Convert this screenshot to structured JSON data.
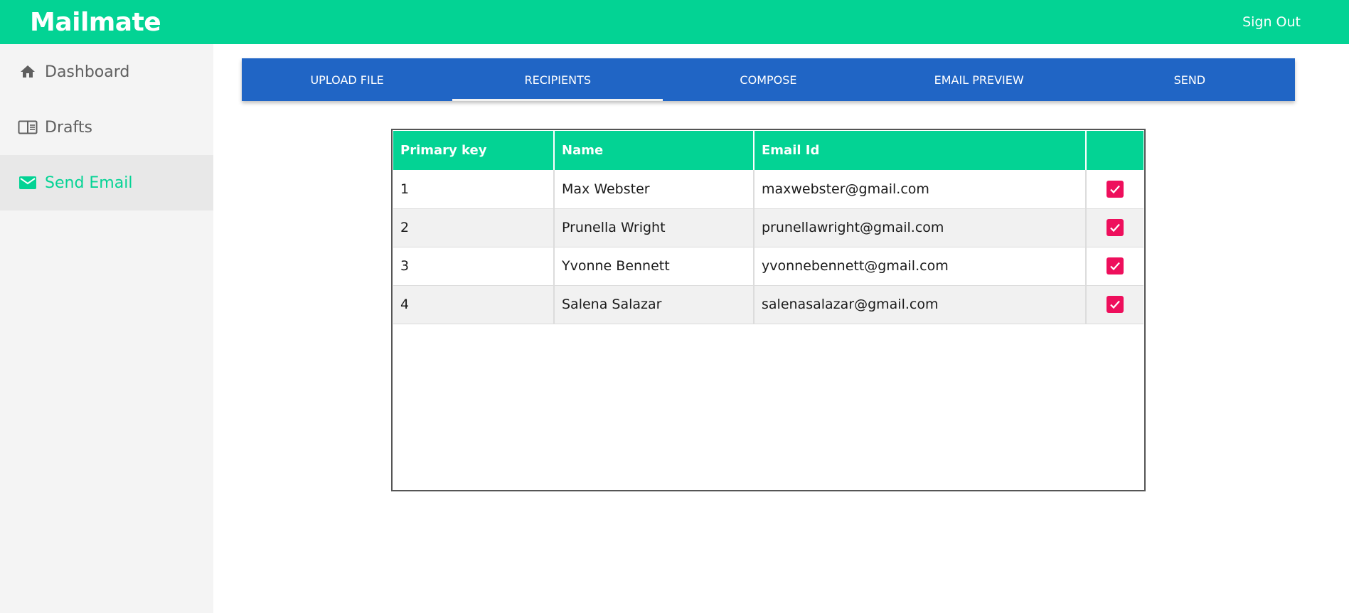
{
  "app": {
    "brand": "Mailmate",
    "sign_out": "Sign Out"
  },
  "sidebar": {
    "items": [
      {
        "label": "Dashboard",
        "icon": "home-icon",
        "active": false
      },
      {
        "label": "Drafts",
        "icon": "drafts-icon",
        "active": false
      },
      {
        "label": "Send Email",
        "icon": "mail-icon",
        "active": true
      }
    ]
  },
  "tabs": [
    {
      "label": "UPLOAD FILE",
      "active": false
    },
    {
      "label": "RECIPIENTS",
      "active": true
    },
    {
      "label": "COMPOSE",
      "active": false
    },
    {
      "label": "EMAIL PREVIEW",
      "active": false
    },
    {
      "label": "SEND",
      "active": false
    }
  ],
  "table": {
    "headers": [
      "Primary key",
      "Name",
      "Email Id",
      ""
    ],
    "rows": [
      {
        "pk": "1",
        "name": "Max Webster",
        "email": "maxwebster@gmail.com",
        "checked": true
      },
      {
        "pk": "2",
        "name": "Prunella Wright",
        "email": "prunellawright@gmail.com",
        "checked": true
      },
      {
        "pk": "3",
        "name": "Yvonne Bennett",
        "email": "yvonnebennett@gmail.com",
        "checked": true
      },
      {
        "pk": "4",
        "name": "Salena Salazar",
        "email": "salenasalazar@gmail.com",
        "checked": true
      }
    ]
  },
  "colors": {
    "brand_green": "#03d394",
    "tab_blue": "#2065c5",
    "checkbox_pink": "#ee0f5c",
    "sidebar_bg": "#f4f4f4"
  }
}
